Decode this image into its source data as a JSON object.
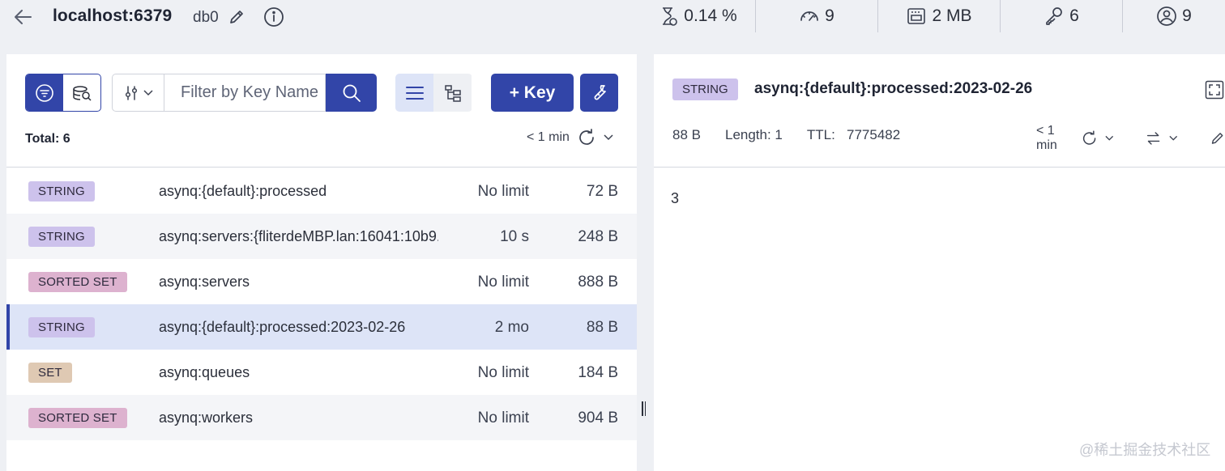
{
  "header": {
    "host": "localhost:6379",
    "db": "db0",
    "stats": [
      {
        "icon": "cpu-hourglass-icon",
        "value": "0.14 %"
      },
      {
        "icon": "gauge-icon",
        "value": "9"
      },
      {
        "icon": "memory-icon",
        "value": "2 MB"
      },
      {
        "icon": "key-icon",
        "value": "6"
      },
      {
        "icon": "user-icon",
        "value": "9"
      }
    ]
  },
  "browser": {
    "filter_placeholder": "Filter by Key Name",
    "add_key_label": "+ Key",
    "total_label": "Total: 6",
    "refresh_label": "< 1 min",
    "keys": [
      {
        "type": "STRING",
        "name": "asynq:{default}:processed",
        "ttl": "No limit",
        "size": "72 B"
      },
      {
        "type": "STRING",
        "name": "asynq:servers:{fliterdeMBP.lan:16041:10b9...",
        "ttl": "10 s",
        "size": "248 B"
      },
      {
        "type": "SORTED SET",
        "name": "asynq:servers",
        "ttl": "No limit",
        "size": "888 B"
      },
      {
        "type": "STRING",
        "name": "asynq:{default}:processed:2023-02-26",
        "ttl": "2 mo",
        "size": "88 B"
      },
      {
        "type": "SET",
        "name": "asynq:queues",
        "ttl": "No limit",
        "size": "184 B"
      },
      {
        "type": "SORTED SET",
        "name": "asynq:workers",
        "ttl": "No limit",
        "size": "904 B"
      }
    ],
    "selected_index": 3
  },
  "details": {
    "type": "STRING",
    "key": "asynq:{default}:processed:2023-02-26",
    "size": "88 B",
    "length": "Length: 1",
    "ttl_label": "TTL:",
    "ttl_value": "7775482",
    "refresh_label": "< 1 min",
    "value": "3"
  },
  "watermark": "@稀土掘金技术社区",
  "colors": {
    "accent": "#3245a8",
    "string_badge": "#cdc2ec",
    "sorted_set_badge": "#ddb2cf",
    "set_badge": "#dfc9b3",
    "selected_row": "#dde4f7"
  }
}
